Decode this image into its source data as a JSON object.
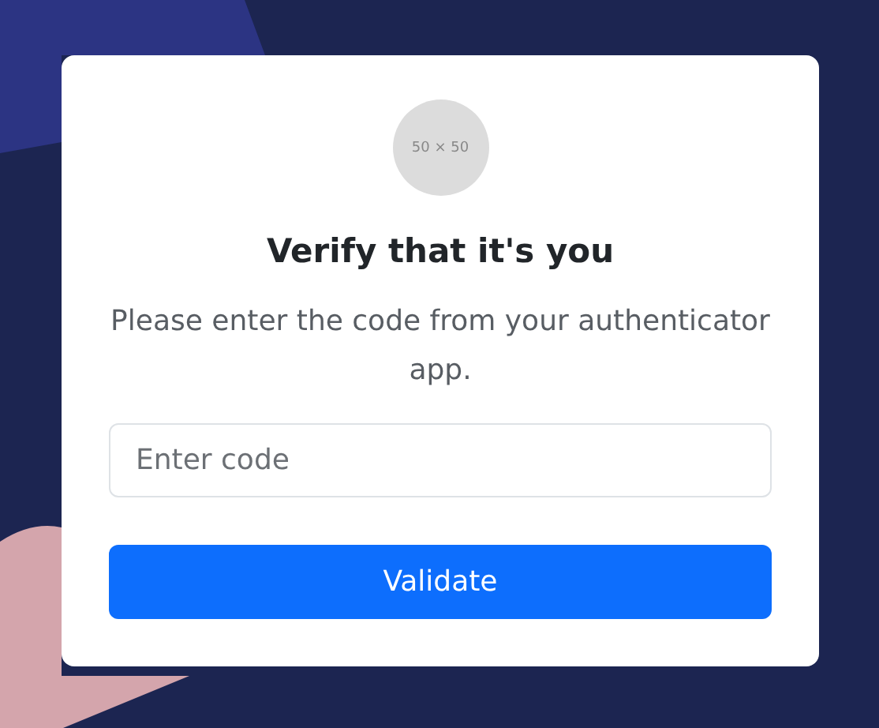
{
  "logo": {
    "text": "50 × 50"
  },
  "title": "Verify that it's you",
  "description": "Please enter the code from your authenticator app.",
  "code_field": {
    "placeholder": "Enter code"
  },
  "submit_button": {
    "label": "Validate"
  }
}
